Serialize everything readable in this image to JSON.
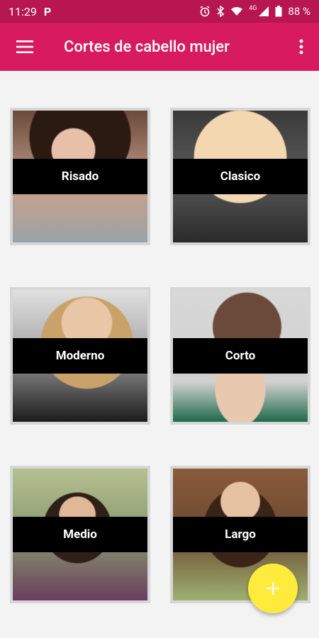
{
  "status": {
    "time": "11:29",
    "app_icon": "P",
    "network": "4G",
    "battery": "88 %"
  },
  "app_bar": {
    "title": "Cortes de cabello mujer"
  },
  "categories": [
    {
      "label": "Risado"
    },
    {
      "label": "Clasico"
    },
    {
      "label": "Moderno"
    },
    {
      "label": "Corto"
    },
    {
      "label": "Medio"
    },
    {
      "label": "Largo"
    }
  ],
  "colors": {
    "status_bar": "#b7164f",
    "app_bar": "#d81b60",
    "fab": "#ffeb3b"
  },
  "icons": {
    "menu": "hamburger-icon",
    "more": "more-vert-icon",
    "fab": "plus-icon"
  }
}
